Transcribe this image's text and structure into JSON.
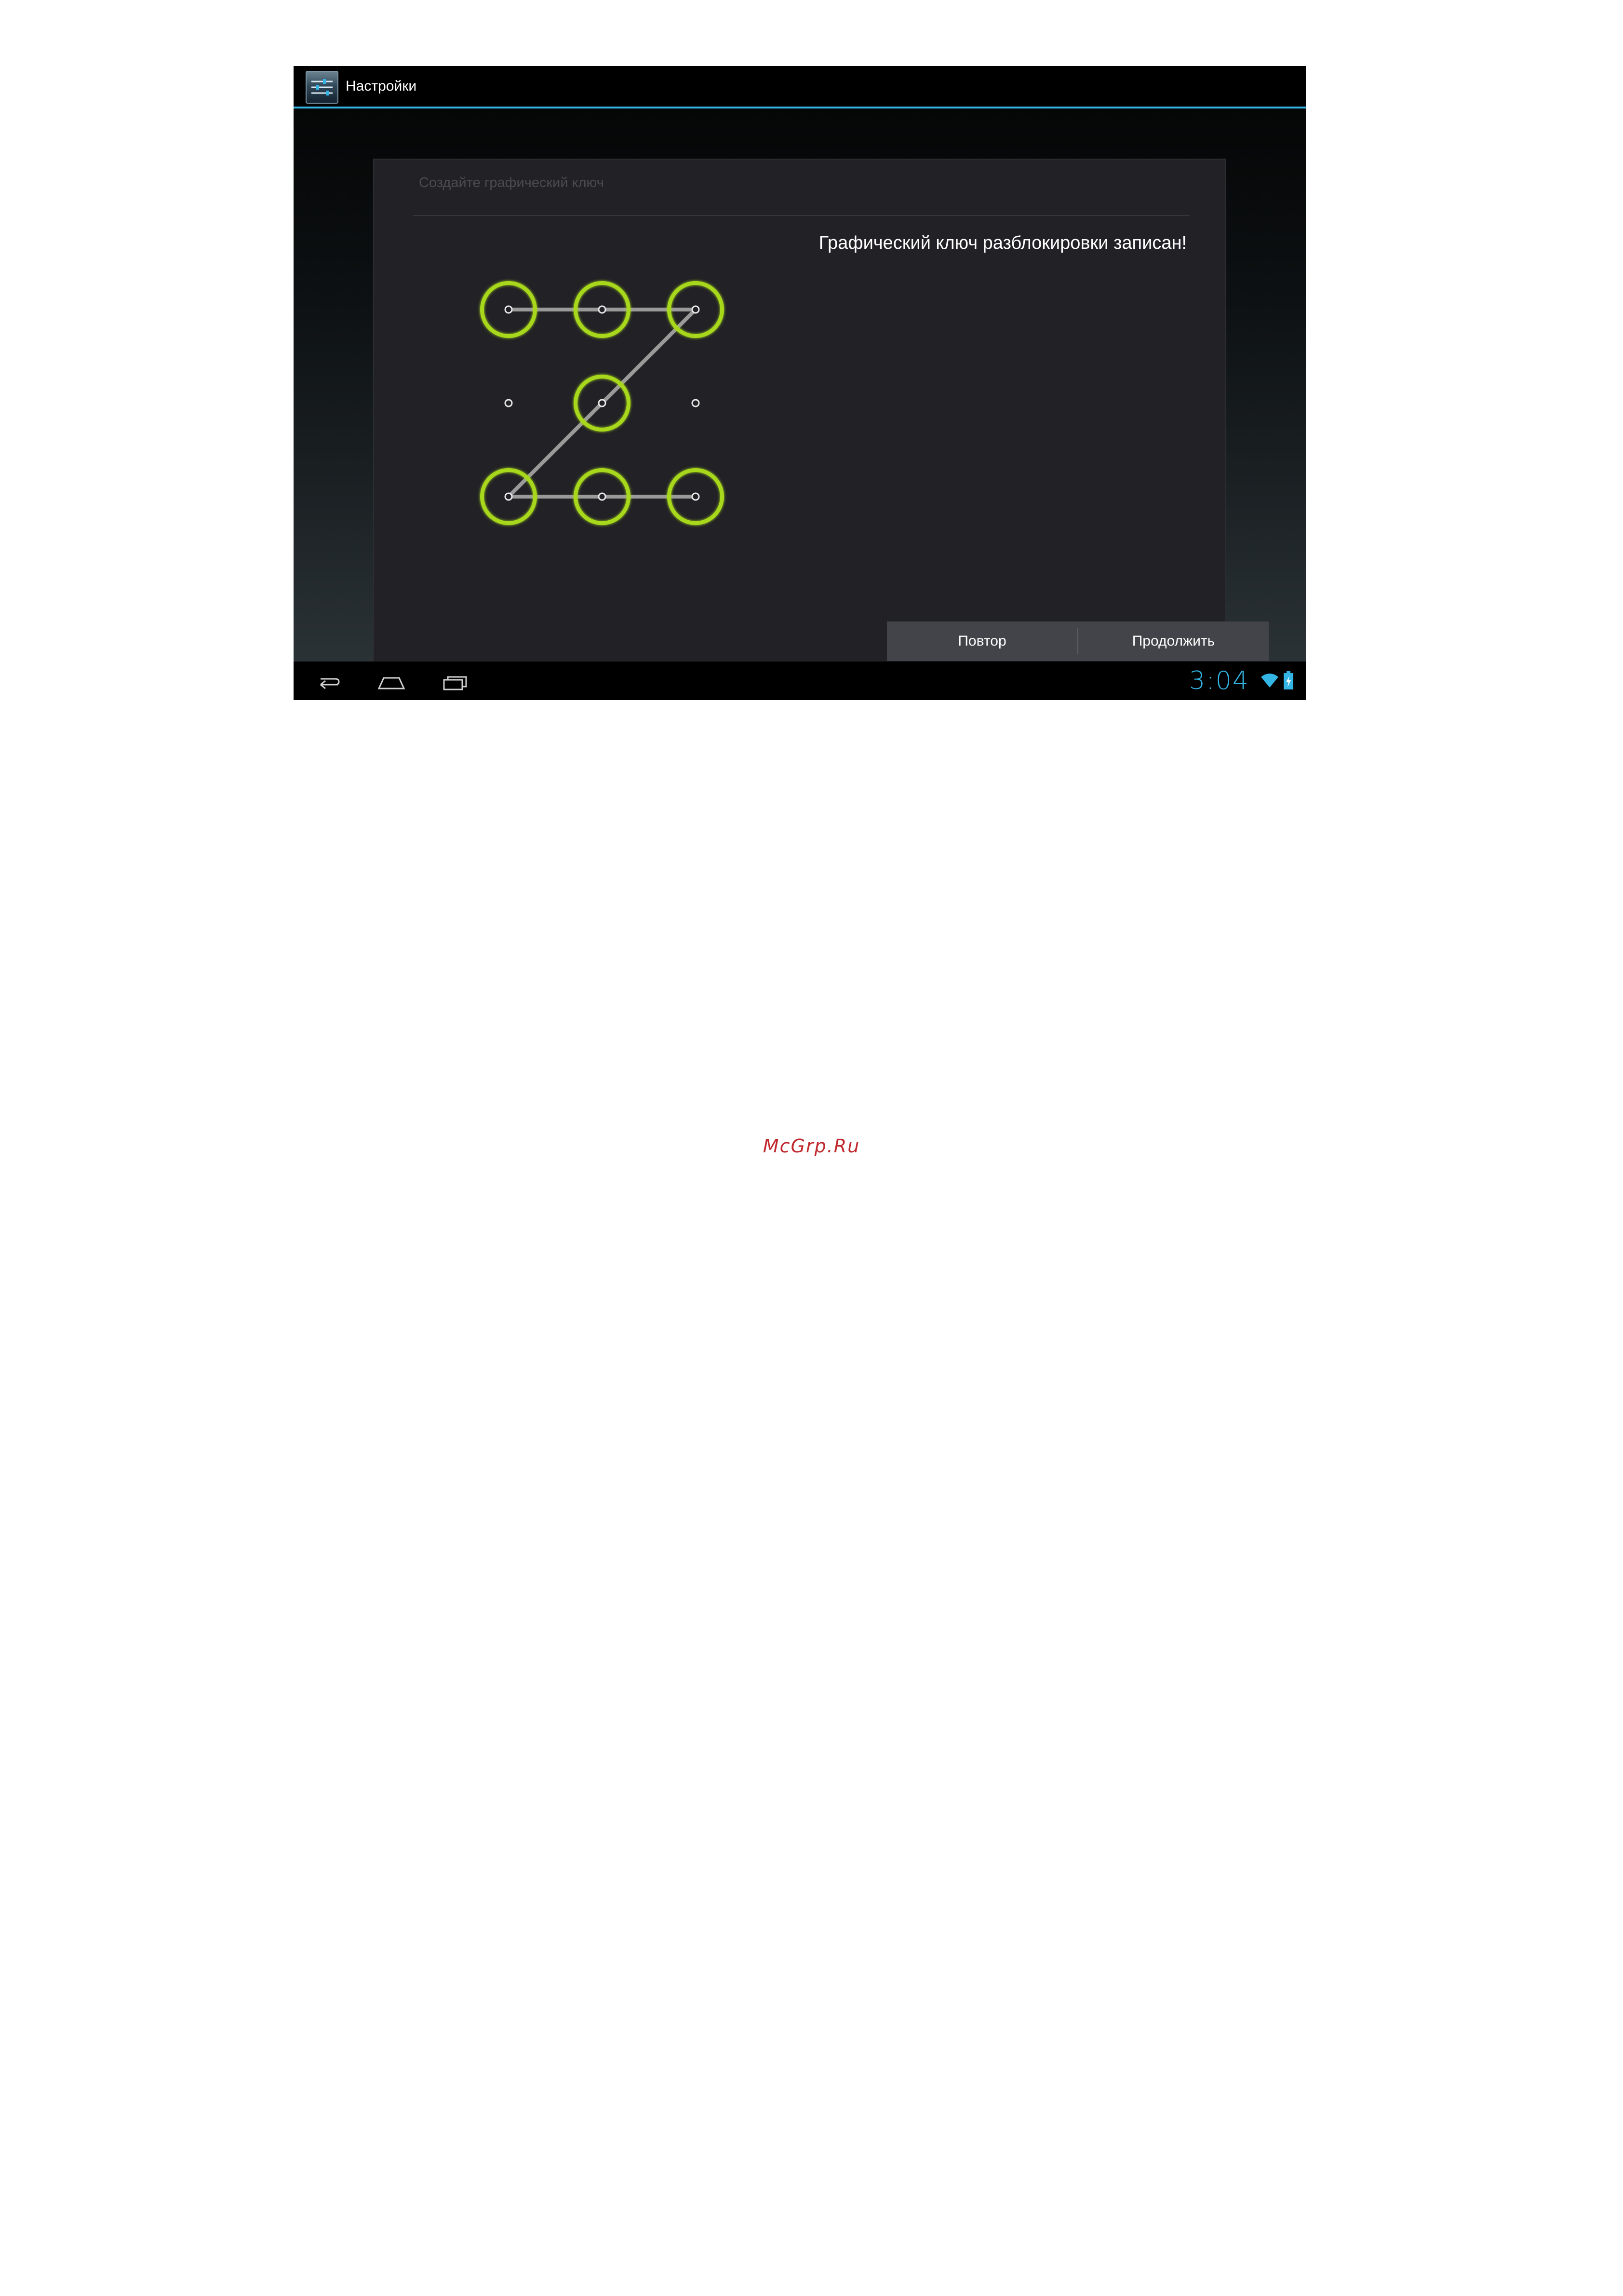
{
  "action_bar": {
    "app_icon": "settings-sliders-icon",
    "title": "Настройки",
    "accent_color": "#33b5e5"
  },
  "panel": {
    "header": "Создайте графический ключ",
    "status_message": "Графический ключ разблокировки записан!"
  },
  "pattern": {
    "grid": "3x3",
    "selected_dots": [
      1,
      2,
      3,
      5,
      7,
      8,
      9
    ],
    "sequence": [
      1,
      2,
      3,
      5,
      7,
      8,
      9
    ],
    "ring_color": "#a8d81a",
    "line_color": "#9a9a9a"
  },
  "buttons": {
    "retry_label": "Повтор",
    "continue_label": "Продолжить"
  },
  "nav_bar": {
    "back": "back-icon",
    "home": "home-icon",
    "recents": "recent-apps-icon"
  },
  "status_bar": {
    "time": "3:04",
    "wifi": "wifi-icon",
    "battery": "battery-charging-icon",
    "accent_color": "#33b5e5"
  },
  "watermark": {
    "text": "McGrp.Ru",
    "color": "#c0282d"
  }
}
